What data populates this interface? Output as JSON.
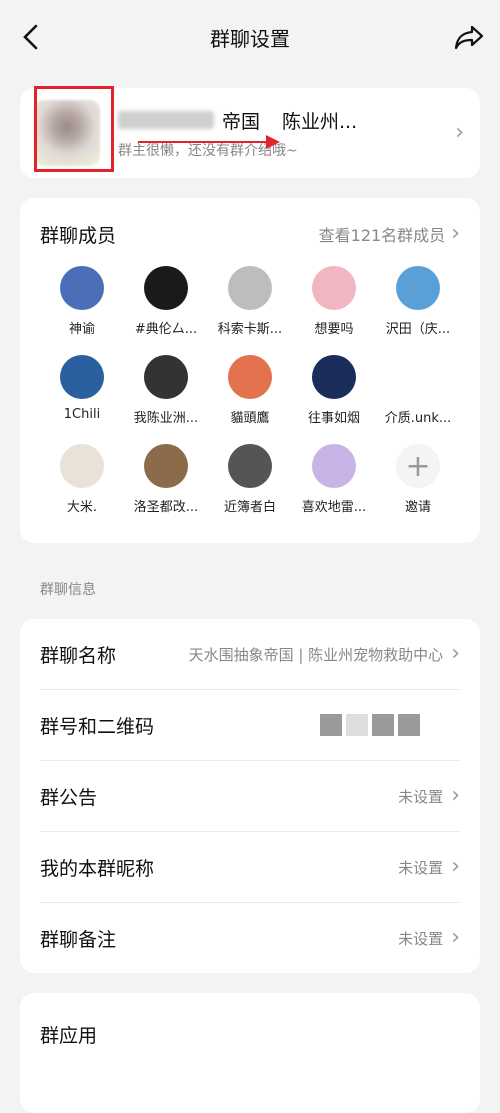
{
  "header": {
    "title": "群聊设置",
    "back_icon": "chevron-left-icon",
    "share_icon": "share-icon"
  },
  "group": {
    "name_visible": "帝国",
    "name_continued": "陈业州...",
    "intro": "群主很懒，还没有群介绍哦~",
    "annotation_color": "#e0242a"
  },
  "members": {
    "title": "群聊成员",
    "view_all": "查看121名群成员",
    "items": [
      {
        "name": "神谕",
        "color": "#4a6fb8"
      },
      {
        "name": "#典伦厶...",
        "color": "#1a1a1a"
      },
      {
        "name": "科索卡斯...",
        "color": "#bdbdbd"
      },
      {
        "name": "想要吗",
        "color": "#f0b7c3"
      },
      {
        "name": "沢田（庆...",
        "color": "#5aa0d8"
      },
      {
        "name": "1Chili",
        "color": "#2a5fa0"
      },
      {
        "name": "我陈业洲...",
        "color": "#333333"
      },
      {
        "name": "貓頭鷹",
        "color": "#e2734e"
      },
      {
        "name": "往事如烟",
        "color": "#1b2d5a"
      },
      {
        "name": "介质.unk...",
        "color": "#ffffff"
      },
      {
        "name": "大米.",
        "color": "#e8e2d8"
      },
      {
        "name": "洛圣都改...",
        "color": "#8b6b4a"
      },
      {
        "name": "近簿者白",
        "color": "#555555"
      },
      {
        "name": "喜欢地雷...",
        "color": "#c8b3e6"
      },
      {
        "name": "邀请",
        "color": "#f4f4f4"
      }
    ]
  },
  "info": {
    "section_label": "群聊信息",
    "rows": [
      {
        "label": "群聊名称",
        "value": "天水围抽象帝国 | 陈业州宠物救助中心"
      },
      {
        "label": "群号和二维码",
        "value": ""
      },
      {
        "label": "群公告",
        "value": "未设置"
      },
      {
        "label": "我的本群昵称",
        "value": "未设置"
      },
      {
        "label": "群聊备注",
        "value": "未设置"
      }
    ]
  },
  "apps": {
    "title": "群应用"
  }
}
